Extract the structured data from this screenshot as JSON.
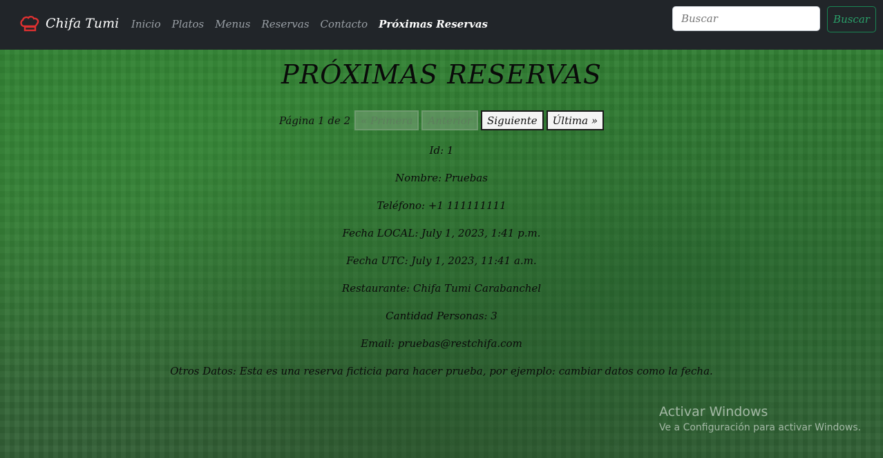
{
  "nav": {
    "brand": "Chifa Tumi",
    "links": [
      "Inicio",
      "Platos",
      "Menus",
      "Reservas",
      "Contacto",
      "Próximas Reservas"
    ],
    "search_placeholder": "Buscar",
    "search_button": "Buscar"
  },
  "page": {
    "title": "PRÓXIMAS RESERVAS",
    "pagination": {
      "info": "Página 1 de 2",
      "first": "« Primera",
      "prev": "Anterior",
      "next": "Siguiente",
      "last": "Última »"
    },
    "reservation": {
      "id": "Id: 1",
      "name": "Nombre: Pruebas",
      "phone": "Teléfono: +1 111111111",
      "local_date": "Fecha LOCAL: July 1, 2023, 1:41 p.m.",
      "utc_date": "Fecha UTC: July 1, 2023, 11:41 a.m.",
      "restaurant": "Restaurante: Chifa Tumi Carabanchel",
      "people": "Cantidad Personas: 3",
      "email": "Email: pruebas@restchifa.com",
      "other": "Otros Datos: Esta es una reserva ficticia para hacer prueba, por ejemplo: cambiar datos como la fecha."
    }
  },
  "watermark": {
    "title": "Activar Windows",
    "subtitle": "Ve a Configuración para activar Windows."
  }
}
